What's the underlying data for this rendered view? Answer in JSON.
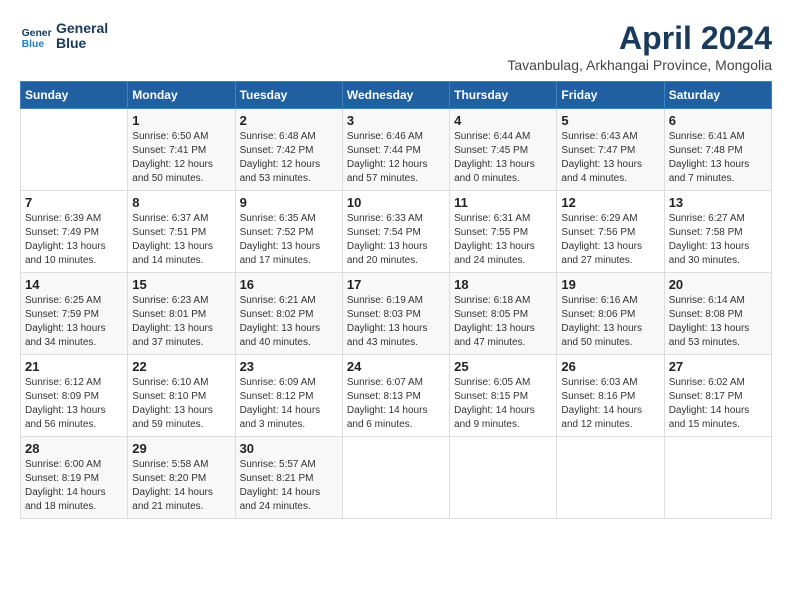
{
  "header": {
    "logo": {
      "line1": "General",
      "line2": "Blue"
    },
    "month_year": "April 2024",
    "location": "Tavanbulag, Arkhangai Province, Mongolia"
  },
  "days_of_week": [
    "Sunday",
    "Monday",
    "Tuesday",
    "Wednesday",
    "Thursday",
    "Friday",
    "Saturday"
  ],
  "weeks": [
    [
      {
        "day": "",
        "info": ""
      },
      {
        "day": "1",
        "info": "Sunrise: 6:50 AM\nSunset: 7:41 PM\nDaylight: 12 hours\nand 50 minutes."
      },
      {
        "day": "2",
        "info": "Sunrise: 6:48 AM\nSunset: 7:42 PM\nDaylight: 12 hours\nand 53 minutes."
      },
      {
        "day": "3",
        "info": "Sunrise: 6:46 AM\nSunset: 7:44 PM\nDaylight: 12 hours\nand 57 minutes."
      },
      {
        "day": "4",
        "info": "Sunrise: 6:44 AM\nSunset: 7:45 PM\nDaylight: 13 hours\nand 0 minutes."
      },
      {
        "day": "5",
        "info": "Sunrise: 6:43 AM\nSunset: 7:47 PM\nDaylight: 13 hours\nand 4 minutes."
      },
      {
        "day": "6",
        "info": "Sunrise: 6:41 AM\nSunset: 7:48 PM\nDaylight: 13 hours\nand 7 minutes."
      }
    ],
    [
      {
        "day": "7",
        "info": "Sunrise: 6:39 AM\nSunset: 7:49 PM\nDaylight: 13 hours\nand 10 minutes."
      },
      {
        "day": "8",
        "info": "Sunrise: 6:37 AM\nSunset: 7:51 PM\nDaylight: 13 hours\nand 14 minutes."
      },
      {
        "day": "9",
        "info": "Sunrise: 6:35 AM\nSunset: 7:52 PM\nDaylight: 13 hours\nand 17 minutes."
      },
      {
        "day": "10",
        "info": "Sunrise: 6:33 AM\nSunset: 7:54 PM\nDaylight: 13 hours\nand 20 minutes."
      },
      {
        "day": "11",
        "info": "Sunrise: 6:31 AM\nSunset: 7:55 PM\nDaylight: 13 hours\nand 24 minutes."
      },
      {
        "day": "12",
        "info": "Sunrise: 6:29 AM\nSunset: 7:56 PM\nDaylight: 13 hours\nand 27 minutes."
      },
      {
        "day": "13",
        "info": "Sunrise: 6:27 AM\nSunset: 7:58 PM\nDaylight: 13 hours\nand 30 minutes."
      }
    ],
    [
      {
        "day": "14",
        "info": "Sunrise: 6:25 AM\nSunset: 7:59 PM\nDaylight: 13 hours\nand 34 minutes."
      },
      {
        "day": "15",
        "info": "Sunrise: 6:23 AM\nSunset: 8:01 PM\nDaylight: 13 hours\nand 37 minutes."
      },
      {
        "day": "16",
        "info": "Sunrise: 6:21 AM\nSunset: 8:02 PM\nDaylight: 13 hours\nand 40 minutes."
      },
      {
        "day": "17",
        "info": "Sunrise: 6:19 AM\nSunset: 8:03 PM\nDaylight: 13 hours\nand 43 minutes."
      },
      {
        "day": "18",
        "info": "Sunrise: 6:18 AM\nSunset: 8:05 PM\nDaylight: 13 hours\nand 47 minutes."
      },
      {
        "day": "19",
        "info": "Sunrise: 6:16 AM\nSunset: 8:06 PM\nDaylight: 13 hours\nand 50 minutes."
      },
      {
        "day": "20",
        "info": "Sunrise: 6:14 AM\nSunset: 8:08 PM\nDaylight: 13 hours\nand 53 minutes."
      }
    ],
    [
      {
        "day": "21",
        "info": "Sunrise: 6:12 AM\nSunset: 8:09 PM\nDaylight: 13 hours\nand 56 minutes."
      },
      {
        "day": "22",
        "info": "Sunrise: 6:10 AM\nSunset: 8:10 PM\nDaylight: 13 hours\nand 59 minutes."
      },
      {
        "day": "23",
        "info": "Sunrise: 6:09 AM\nSunset: 8:12 PM\nDaylight: 14 hours\nand 3 minutes."
      },
      {
        "day": "24",
        "info": "Sunrise: 6:07 AM\nSunset: 8:13 PM\nDaylight: 14 hours\nand 6 minutes."
      },
      {
        "day": "25",
        "info": "Sunrise: 6:05 AM\nSunset: 8:15 PM\nDaylight: 14 hours\nand 9 minutes."
      },
      {
        "day": "26",
        "info": "Sunrise: 6:03 AM\nSunset: 8:16 PM\nDaylight: 14 hours\nand 12 minutes."
      },
      {
        "day": "27",
        "info": "Sunrise: 6:02 AM\nSunset: 8:17 PM\nDaylight: 14 hours\nand 15 minutes."
      }
    ],
    [
      {
        "day": "28",
        "info": "Sunrise: 6:00 AM\nSunset: 8:19 PM\nDaylight: 14 hours\nand 18 minutes."
      },
      {
        "day": "29",
        "info": "Sunrise: 5:58 AM\nSunset: 8:20 PM\nDaylight: 14 hours\nand 21 minutes."
      },
      {
        "day": "30",
        "info": "Sunrise: 5:57 AM\nSunset: 8:21 PM\nDaylight: 14 hours\nand 24 minutes."
      },
      {
        "day": "",
        "info": ""
      },
      {
        "day": "",
        "info": ""
      },
      {
        "day": "",
        "info": ""
      },
      {
        "day": "",
        "info": ""
      }
    ]
  ]
}
